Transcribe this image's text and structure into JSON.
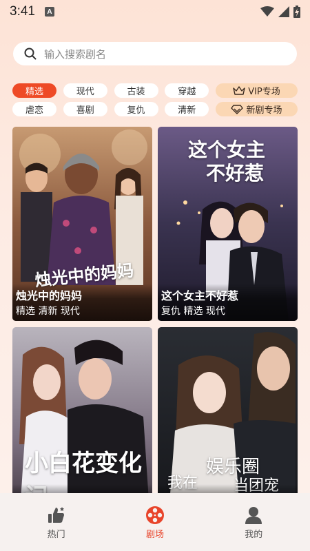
{
  "status": {
    "time": "3:41",
    "notif_letter": "A"
  },
  "search": {
    "placeholder": "输入搜索剧名"
  },
  "chips": {
    "row1": [
      "精选",
      "现代",
      "古装",
      "穿越"
    ],
    "row1_special": "VIP专场",
    "row2": [
      "虐恋",
      "喜剧",
      "复仇",
      "清新"
    ],
    "row2_special": "新剧专场"
  },
  "cards": [
    {
      "title": "烛光中的妈妈",
      "tags": "精选 清新 现代",
      "poster_text": "烛光中的妈妈"
    },
    {
      "title": "这个女主不好惹",
      "tags": "复仇 精选 现代",
      "poster_text_1": "这个女主",
      "poster_text_2": "不好惹"
    },
    {
      "title": "小白花变化记",
      "tags": "",
      "poster_text": "小白花变化记"
    },
    {
      "title": "我在娱乐圈当团宠",
      "tags": "",
      "poster_text_1": "娱乐圈",
      "poster_text_2": "我在",
      "poster_text_3": "当团宠"
    }
  ],
  "tabbar": {
    "hot": "热门",
    "theater": "剧场",
    "mine": "我的"
  },
  "colors": {
    "accent": "#ee4a26",
    "vip_chip": "#fbd7b4"
  }
}
